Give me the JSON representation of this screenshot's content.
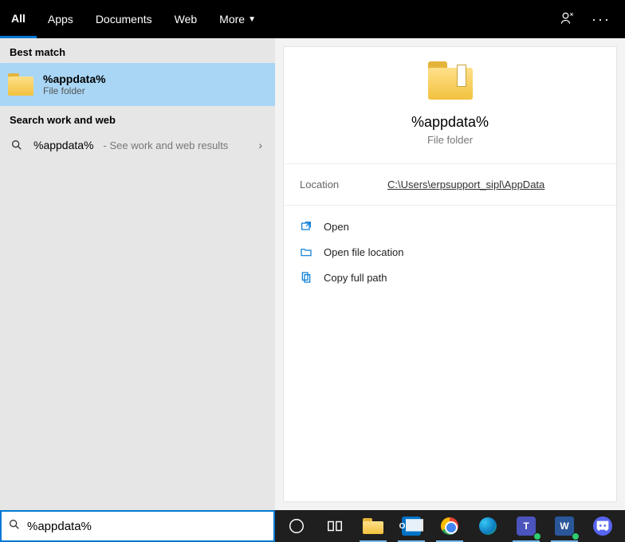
{
  "tabs": {
    "all": "All",
    "apps": "Apps",
    "documents": "Documents",
    "web": "Web",
    "more": "More"
  },
  "results": {
    "best_match_header": "Best match",
    "best_match_title": "%appdata%",
    "best_match_sub": "File folder",
    "work_web_header": "Search work and web",
    "work_web_title": "%appdata%",
    "work_web_sub": " - See work and web results"
  },
  "preview": {
    "title": "%appdata%",
    "sub": "File folder",
    "location_label": "Location",
    "location_value": "C:\\Users\\erpsupport_sipl\\AppData",
    "actions": {
      "open": "Open",
      "open_location": "Open file location",
      "copy_path": "Copy full path"
    }
  },
  "search": {
    "value": "%appdata%"
  }
}
